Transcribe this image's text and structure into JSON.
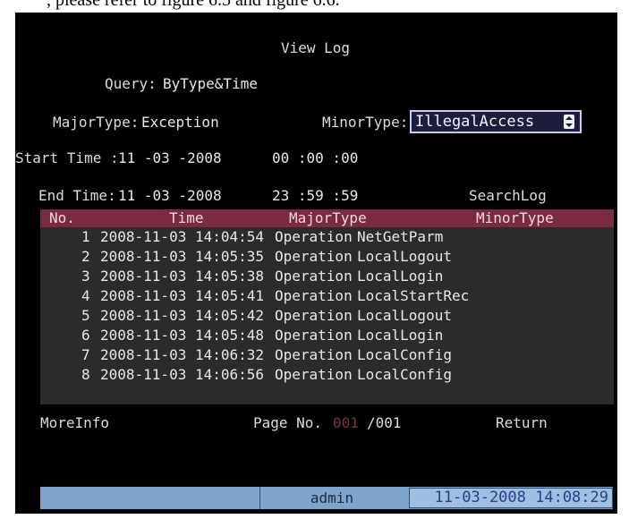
{
  "page": {
    "cut_caption": ", please refer to figure 6.5 and figure 6.6."
  },
  "title": "View Log",
  "query": {
    "label": "Query:",
    "value": "ByType&Time"
  },
  "major_type": {
    "label": "MajorType:",
    "value": "Exception"
  },
  "minor_type": {
    "label": "MinorType:",
    "value": "IllegalAccess"
  },
  "start_time": {
    "label": "Start Time :",
    "date": "11 -03 -2008",
    "time": "00 :00 :00"
  },
  "end_time": {
    "label": "End Time:",
    "date": "11 -03 -2008",
    "time": "23 :59 :59"
  },
  "search_log_label": "SearchLog",
  "table": {
    "columns": [
      "No.",
      "Time",
      "MajorType",
      "MinorType"
    ],
    "rows": [
      {
        "no": "1",
        "time": "2008-11-03 14:04:54",
        "major": "Operation",
        "minor": "NetGetParm"
      },
      {
        "no": "2",
        "time": "2008-11-03 14:05:35",
        "major": "Operation",
        "minor": "LocalLogout"
      },
      {
        "no": "3",
        "time": "2008-11-03 14:05:38",
        "major": "Operation",
        "minor": "LocalLogin"
      },
      {
        "no": "4",
        "time": "2008-11-03 14:05:41",
        "major": "Operation",
        "minor": "LocalStartRec"
      },
      {
        "no": "5",
        "time": "2008-11-03 14:05:42",
        "major": "Operation",
        "minor": "LocalLogout"
      },
      {
        "no": "6",
        "time": "2008-11-03 14:05:48",
        "major": "Operation",
        "minor": "LocalLogin"
      },
      {
        "no": "7",
        "time": "2008-11-03 14:06:32",
        "major": "Operation",
        "minor": "LocalConfig"
      },
      {
        "no": "8",
        "time": "2008-11-03 14:06:56",
        "major": "Operation",
        "minor": "LocalConfig"
      }
    ]
  },
  "more_info_label": "MoreInfo",
  "pager": {
    "label": "Page No.",
    "current": "001",
    "total": "/001"
  },
  "return_label": "Return",
  "status_bar": {
    "user": "admin",
    "datetime": "11-03-2008 14:08:29"
  },
  "colors": {
    "header_bar": "#7a2c3e",
    "table_body": "#2b2b2b",
    "status_bar": "#7da4cc",
    "clock_text": "#2a3e8a"
  }
}
